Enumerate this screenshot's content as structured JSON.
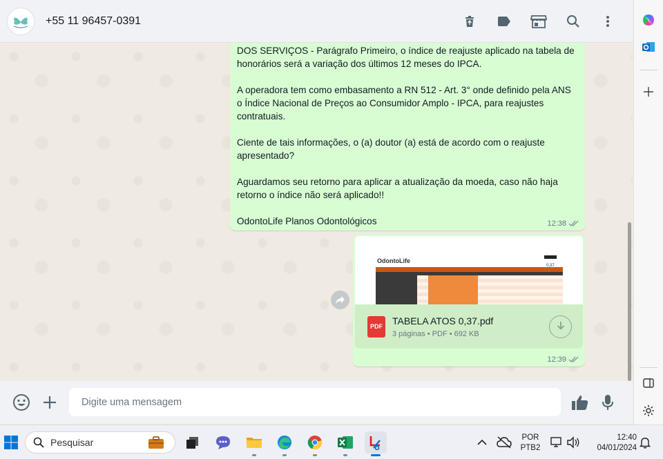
{
  "header": {
    "contact_name": "+55 11 96457-0391",
    "icons": [
      "trash-icon",
      "label-icon",
      "store-icon",
      "search-icon",
      "menu-icon"
    ]
  },
  "messages": [
    {
      "type": "text",
      "paragraphs": [
        "DOS SERVIÇOS - Parágrafo Primeiro, o índice de reajuste aplicado na tabela de honorários será a variação dos últimos 12 meses do IPCA.",
        "A operadora tem como embasamento a RN 512 - Art. 3° onde definido pela ANS o Índice Nacional de Preços ao Consumidor Amplo - IPCA, para reajustes contratuais.",
        "Ciente de tais informações, o (a) doutor (a) está de acordo com o reajuste apresentado?",
        "Aguardamos seu retorno para aplicar a atualização da moeda, caso não haja retorno o índice não será aplicado!!",
        "OdontoLife Planos Odontológicos"
      ],
      "time": "12:38"
    },
    {
      "type": "document",
      "file_name": "TABELA ATOS 0,37.pdf",
      "file_meta": "3 páginas • PDF • 692 KB",
      "badge": "PDF",
      "preview_brand": "OdontoLife",
      "preview_value": "0,37",
      "time": "12:39"
    }
  ],
  "composer": {
    "placeholder": "Digite uma mensagem"
  },
  "taskbar": {
    "search_placeholder": "Pesquisar",
    "language": "POR",
    "keyboard": "PTB2",
    "time": "12:40",
    "date": "04/01/2024"
  },
  "colors": {
    "outgoing_bubble": "#d9fdd3",
    "chat_bg": "#efeae2",
    "header_bg": "#f0f2f5",
    "pdf_red": "#e53935",
    "tick_gray": "#8696a0"
  }
}
